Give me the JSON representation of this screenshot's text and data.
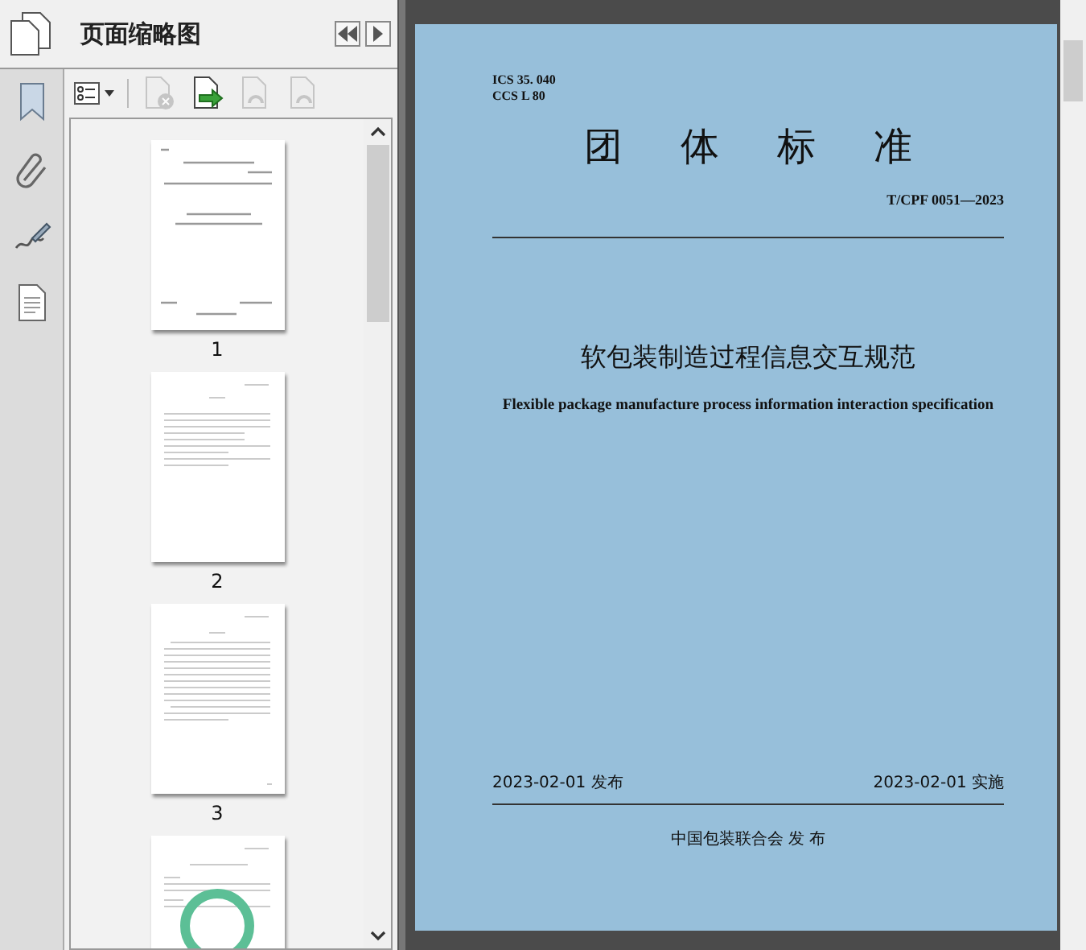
{
  "panel": {
    "title": "页面缩略图"
  },
  "toolbar": [
    {
      "kind": "options",
      "disabled": false
    },
    {
      "kind": "delete",
      "disabled": true
    },
    {
      "kind": "insert",
      "disabled": false
    },
    {
      "kind": "undo",
      "disabled": true
    },
    {
      "kind": "redo",
      "disabled": true
    }
  ],
  "thumbnails": [
    {
      "label": "1",
      "kind": "cover"
    },
    {
      "label": "2",
      "kind": "contents"
    },
    {
      "label": "3",
      "kind": "text"
    },
    {
      "kind": "seal"
    }
  ],
  "document": {
    "ics": "ICS 35. 040",
    "ccs": "CCS L 80",
    "heading": "团体标准",
    "code": "T/CPF 0051—2023",
    "title": "软包装制造过程信息交互规范",
    "title_en": "Flexible package manufacture process information interaction specification",
    "released": "2023-02-01 发布",
    "implemented": "2023-02-01 实施",
    "publisher": "中国包装联合会 发 布"
  }
}
